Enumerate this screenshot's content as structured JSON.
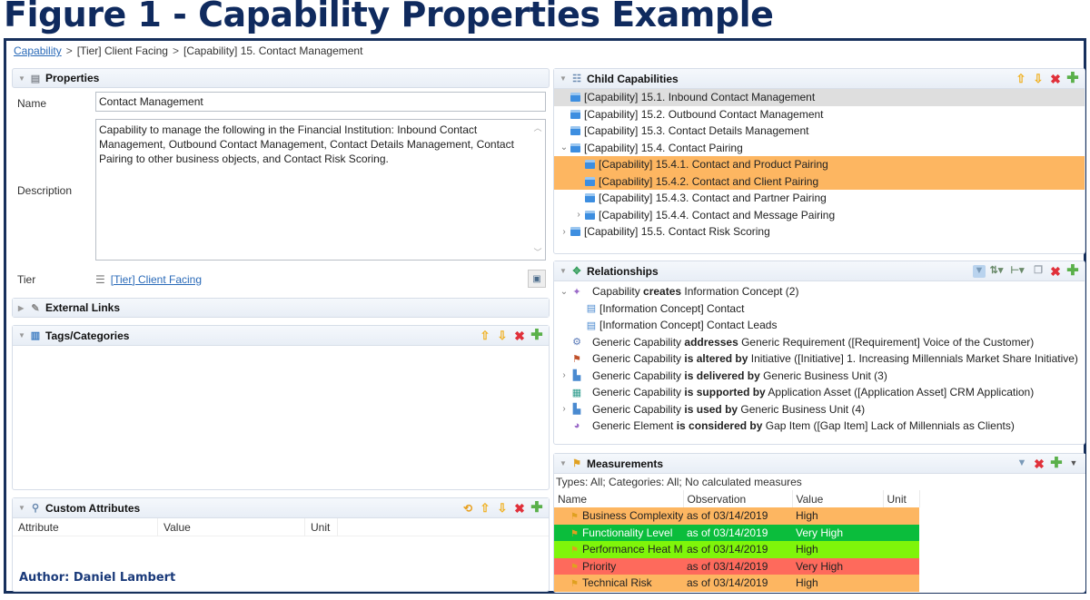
{
  "figure_title": "Figure 1 - Capability Properties Example",
  "breadcrumb": {
    "root": "Capability",
    "separator": ">",
    "items": [
      "[Tier] Client Facing",
      "[Capability] 15. Contact Management"
    ]
  },
  "properties": {
    "title": "Properties",
    "name_label": "Name",
    "name_value": "Contact Management",
    "description_label": "Description",
    "description_value": "Capability to manage the following in the Financial Institution: Inbound Contact Management, Outbound Contact Management, Contact Details Management, Contact Pairing to other business objects, and Contact Risk Scoring.",
    "tier_label": "Tier",
    "tier_value": "[Tier] Client Facing"
  },
  "external_links": {
    "title": "External Links"
  },
  "tags": {
    "title": "Tags/Categories"
  },
  "custom_attributes": {
    "title": "Custom Attributes",
    "columns": [
      "Attribute",
      "Value",
      "Unit"
    ]
  },
  "author": "Author: Daniel Lambert",
  "child_capabilities": {
    "title": "Child Capabilities",
    "items": [
      {
        "label": "[Capability] 15.1. Inbound Contact Management",
        "level": 0,
        "expander": "",
        "highlight": "grey"
      },
      {
        "label": "[Capability] 15.2. Outbound Contact Management",
        "level": 0,
        "expander": "",
        "highlight": ""
      },
      {
        "label": "[Capability] 15.3. Contact Details Management",
        "level": 0,
        "expander": "",
        "highlight": ""
      },
      {
        "label": "[Capability] 15.4. Contact Pairing",
        "level": 0,
        "expander": "expanded",
        "highlight": ""
      },
      {
        "label": "[Capability] 15.4.1. Contact and Product Pairing",
        "level": 1,
        "expander": "",
        "highlight": "orange"
      },
      {
        "label": "[Capability] 15.4.2. Contact and Client Pairing",
        "level": 1,
        "expander": "",
        "highlight": "orange"
      },
      {
        "label": "[Capability] 15.4.3. Contact and Partner Pairing",
        "level": 1,
        "expander": "",
        "highlight": ""
      },
      {
        "label": "[Capability] 15.4.4. Contact and Message Pairing",
        "level": 1,
        "expander": "collapsed",
        "highlight": ""
      },
      {
        "label": "[Capability] 15.5. Contact Risk Scoring",
        "level": 0,
        "expander": "collapsed",
        "highlight": ""
      }
    ]
  },
  "relationships": {
    "title": "Relationships",
    "rows": [
      {
        "expander": "expanded",
        "icon": "create-relation-icon",
        "level": 0,
        "pre": "Capability ",
        "verb": "creates",
        "post": " Information Concept (2)"
      },
      {
        "expander": "",
        "icon": "information-concept-icon",
        "level": 1,
        "pre": "[Information Concept] Contact",
        "verb": "",
        "post": ""
      },
      {
        "expander": "",
        "icon": "information-concept-icon",
        "level": 1,
        "pre": "[Information Concept] Contact Leads",
        "verb": "",
        "post": ""
      },
      {
        "expander": "",
        "icon": "requirement-icon",
        "level": 0,
        "pre": "Generic Capability ",
        "verb": "addresses",
        "post": " Generic Requirement ([Requirement] Voice of the Customer)"
      },
      {
        "expander": "",
        "icon": "initiative-icon",
        "level": 0,
        "pre": "Generic Capability ",
        "verb": "is altered by",
        "post": " Initiative ([Initiative] 1. Increasing Millennials Market Share Initiative)"
      },
      {
        "expander": "collapsed",
        "icon": "business-unit-icon",
        "level": 0,
        "pre": "Generic Capability ",
        "verb": "is delivered by",
        "post": " Generic Business Unit (3)"
      },
      {
        "expander": "",
        "icon": "application-asset-icon",
        "level": 0,
        "pre": "Generic Capability ",
        "verb": "is supported by",
        "post": " Application Asset ([Application Asset] CRM Application)"
      },
      {
        "expander": "collapsed",
        "icon": "business-unit-icon",
        "level": 0,
        "pre": "Generic Capability ",
        "verb": "is used by",
        "post": " Generic Business Unit (4)"
      },
      {
        "expander": "",
        "icon": "gap-item-icon",
        "level": 0,
        "pre": "Generic Element ",
        "verb": "is considered by",
        "post": " Gap Item ([Gap Item] Lack of Millennials as Clients)"
      }
    ]
  },
  "measurements": {
    "title": "Measurements",
    "filter_text": "Types: All; Categories: All; No calculated measures",
    "columns": [
      "Name",
      "Observation",
      "Value",
      "Unit"
    ],
    "rows": [
      {
        "name": "Business Complexity",
        "observation": "as of 03/14/2019",
        "value": "High",
        "unit": "",
        "color": "#fdb661",
        "text_color": "#222222"
      },
      {
        "name": "Functionality Level",
        "observation": "as of 03/14/2019",
        "value": "Very High",
        "unit": "",
        "color": "#0bbd3c",
        "text_color": "#ffffff"
      },
      {
        "name": "Performance Heat Map",
        "observation": "as of 03/14/2019",
        "value": "High",
        "unit": "",
        "color": "#7ff50a",
        "text_color": "#222222"
      },
      {
        "name": "Priority",
        "observation": "as of 03/14/2019",
        "value": "Very High",
        "unit": "",
        "color": "#fe6a5c",
        "text_color": "#222222"
      },
      {
        "name": "Technical Risk",
        "observation": "as of 03/14/2019",
        "value": "High",
        "unit": "",
        "color": "#fdb661",
        "text_color": "#222222"
      }
    ]
  },
  "colors": {
    "title": "#0f2a5e",
    "frame_border": "#17305c",
    "link": "#2a6ab8",
    "selection_orange": "#fdb661",
    "selection_grey": "#dedede"
  }
}
